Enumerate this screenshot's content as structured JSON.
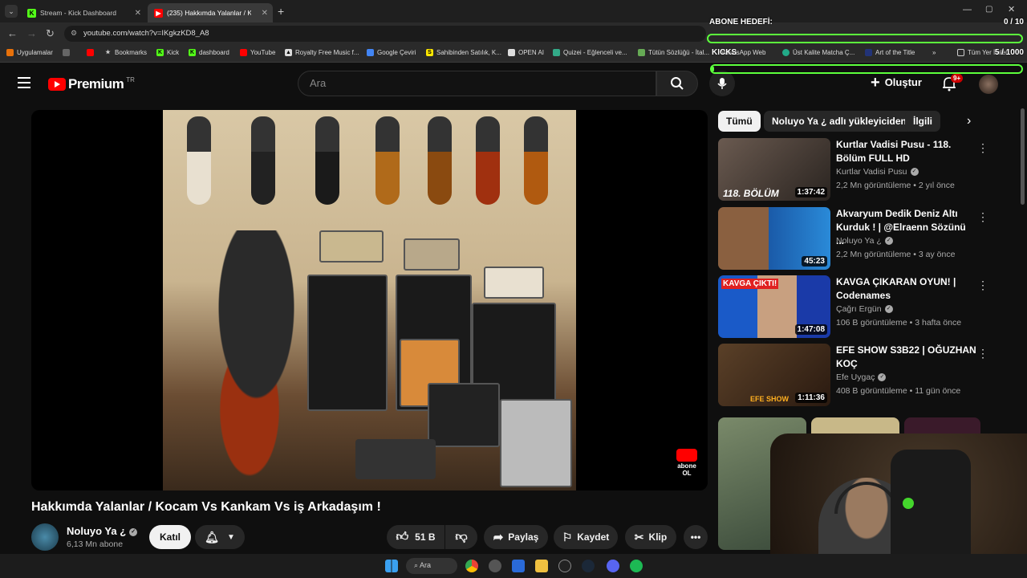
{
  "browser": {
    "tabs": [
      {
        "label": "Stream - Kick Dashboard",
        "active": false
      },
      {
        "label": "(235) Hakkımda Yalanlar / K",
        "active": true
      }
    ],
    "url": "youtube.com/watch?v=IKgkzKD8_A8",
    "bookmarks": [
      "Uygulamalar",
      "Bookmarks",
      "Kick",
      "dashboard",
      "YouTube",
      "Royalty Free Music f...",
      "Google Çeviri",
      "Sahibinden Satılık, K...",
      "OPEN AI",
      "Quizei - Eğlenceli ve...",
      "Tütün Sözlüğü - İtal...",
      "WhatsApp Web",
      "Üst Kalite Matcha Ç...",
      "Art of the Title",
      "Tüm Yer İmleri"
    ]
  },
  "overlay": {
    "goal_label": "ABONE HEDEFİ:",
    "goal_count": "0 / 10",
    "goal_progress": 0.0,
    "kicks_label": "KICKS",
    "kicks_count": "5 / 1000",
    "kicks_progress": 0.005
  },
  "youtube": {
    "logo": "Premium",
    "region": "TR",
    "search_placeholder": "Ara",
    "create_label": "Oluştur",
    "notif_badge": "9+",
    "video": {
      "title": "Hakkımda Yalanlar / Kocam Vs Kankam Vs iş Arkadaşım !",
      "channel": "Noluyo Ya ¿",
      "subs": "6,13 Mn abone",
      "join_label": "Katıl",
      "likes": "51 B",
      "share_label": "Paylaş",
      "save_label": "Kaydet",
      "clip_label": "Klip",
      "watermark": "abone OL"
    },
    "chips": [
      "Tümü",
      "Noluyo Ya ¿ adlı yükleyiciden",
      "İlgili"
    ],
    "recommendations": [
      {
        "title": "Kurtlar Vadisi Pusu - 118. Bölüm FULL HD",
        "channel": "Kurtlar Vadisi Pusu",
        "meta": "2,2 Mn görüntüleme • 2 yıl önce",
        "duration": "1:37:42",
        "thumb_text": "118. BÖLÜM"
      },
      {
        "title": "Akvaryum Dedik Deniz Altı Kurduk ! | @Elraenn Sözünü ...",
        "channel": "Noluyo Ya ¿",
        "meta": "2,2 Mn görüntüleme • 3 ay önce",
        "duration": "45:23",
        "thumb_text": ""
      },
      {
        "title": "KAVGA ÇIKARAN OYUN! | Codenames",
        "channel": "Çağrı Ergün",
        "meta": "106 B görüntüleme • 3 hafta önce",
        "duration": "1:47:08",
        "thumb_text": "KAVGA ÇIKTI!"
      },
      {
        "title": "EFE SHOW S3B22 | OĞUZHAN KOÇ",
        "channel": "Efe Uygaç",
        "meta": "408 B görüntüleme • 11 gün önce",
        "duration": "1:11:36",
        "thumb_text": "EFE SHOW"
      }
    ]
  },
  "taskbar": {
    "search_label": "Ara"
  }
}
